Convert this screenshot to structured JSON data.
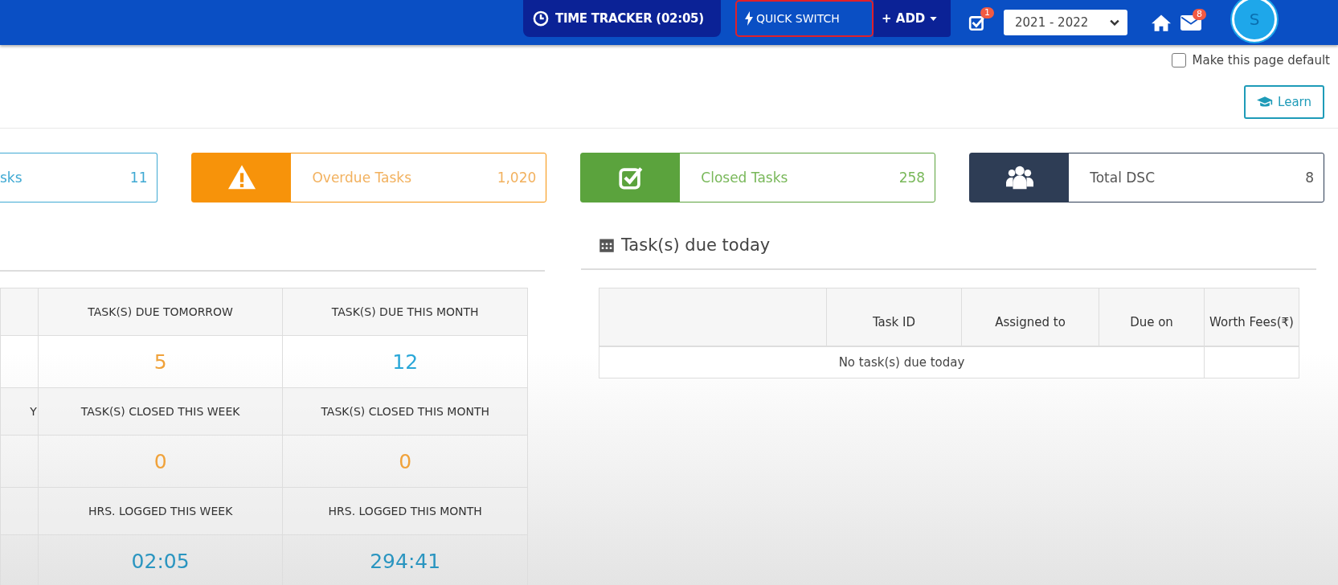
{
  "topbar": {
    "time_tracker": "TIME TRACKER (02:05)",
    "quick_switch": {
      "label": "QUICK SWITCH",
      "selected": true
    },
    "add": "+ ADD",
    "tasks_badge": "1",
    "year": "2021 - 2022",
    "mail_badge": "8",
    "avatar": "S"
  },
  "default_checkbox": {
    "label": "Make this page default",
    "checked": false
  },
  "learn": "Learn",
  "cards": [
    {
      "kind": "partial",
      "label": "sks",
      "value": "11",
      "color": "#3fa9d3"
    },
    {
      "kind": "overdue",
      "label": "Overdue Tasks",
      "value": "1,020",
      "color": "#f7930a"
    },
    {
      "kind": "closed",
      "label": "Closed Tasks",
      "value": "258",
      "color": "#5ba33d"
    },
    {
      "kind": "dsc",
      "label": "Total DSC",
      "value": "8",
      "color": "#2e3d55"
    }
  ],
  "summary_table": {
    "rows": [
      {
        "kind": "header",
        "cells": [
          {
            "text": ""
          },
          {
            "text": "TASK(S) DUE TOMORROW"
          },
          {
            "text": "TASK(S) DUE THIS MONTH"
          }
        ]
      },
      {
        "kind": "value",
        "cells": [
          {
            "text": ""
          },
          {
            "text": "5",
            "color": "#f0a23a"
          },
          {
            "text": "12",
            "color": "#29a7d8"
          }
        ]
      },
      {
        "kind": "header",
        "cells": [
          {
            "text": "Y"
          },
          {
            "text": "TASK(S) CLOSED THIS WEEK"
          },
          {
            "text": "TASK(S) CLOSED THIS MONTH"
          }
        ]
      },
      {
        "kind": "value",
        "cells": [
          {
            "text": ""
          },
          {
            "text": "0",
            "color": "#f0a23a"
          },
          {
            "text": "0",
            "color": "#f0a23a"
          }
        ]
      },
      {
        "kind": "header",
        "cells": [
          {
            "text": ""
          },
          {
            "text": "HRS. LOGGED THIS WEEK"
          },
          {
            "text": "HRS. LOGGED THIS MONTH"
          }
        ]
      },
      {
        "kind": "value",
        "cells": [
          {
            "text": ""
          },
          {
            "text": "02:05",
            "color": "#2a95c0"
          },
          {
            "text": "294:41",
            "color": "#2a95c0"
          }
        ]
      }
    ]
  },
  "due_today": {
    "title": "Task(s) due today",
    "columns": [
      "",
      "Task ID",
      "Assigned to",
      "Due on",
      "Worth Fees(₹)"
    ],
    "empty": "No task(s) due today"
  }
}
